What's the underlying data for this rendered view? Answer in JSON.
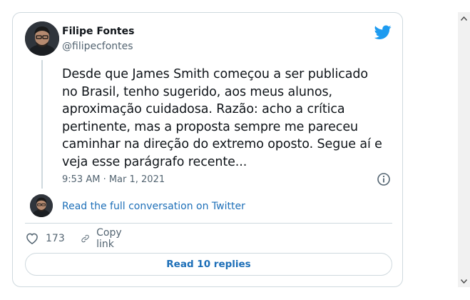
{
  "tweet": {
    "author_name": "Filipe Fontes",
    "author_handle": "@filipecfontes",
    "text_lines": [
      "Desde que James Smith começou a ser publicado",
      "no Brasil, tenho sugerido, aos meus alunos,",
      "aproximação cuidadosa. Razão: acho a crítica",
      "pertinente, mas a proposta sempre me pareceu",
      "caminhar na direção do extremo oposto. Segue aí e",
      "veja esse parágrafo recente..."
    ],
    "timestamp": "9:53 AM · Mar 1, 2021",
    "conversation_link": "Read the full conversation on Twitter",
    "likes_count": "173",
    "copy_link_label": "Copy link",
    "replies_button": "Read 10 replies"
  },
  "colors": {
    "twitter_blue": "#1d9bf0",
    "link_blue": "#1d6fb8",
    "secondary_text": "#536471",
    "border": "#cfd9de"
  },
  "icons": {
    "brand": "twitter-bird-icon",
    "info": "info-icon",
    "like": "heart-icon",
    "copy": "link-icon",
    "scroll_up": "chevron-up-icon",
    "scroll_down": "chevron-down-icon"
  }
}
